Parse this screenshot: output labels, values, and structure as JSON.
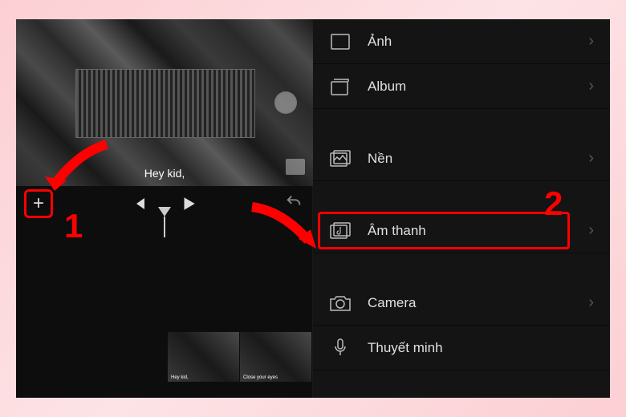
{
  "preview": {
    "subtitle": "Hey kid,"
  },
  "controls": {
    "add": "+"
  },
  "timeline": {
    "clip1_label": "Hey kid,",
    "clip2_label": "Close your eyes"
  },
  "menu": {
    "image": "Ảnh",
    "album": "Album",
    "background": "Nền",
    "audio": "Âm thanh",
    "camera": "Camera",
    "voiceover": "Thuyết minh"
  },
  "annotations": {
    "step1": "1",
    "step2": "2"
  }
}
